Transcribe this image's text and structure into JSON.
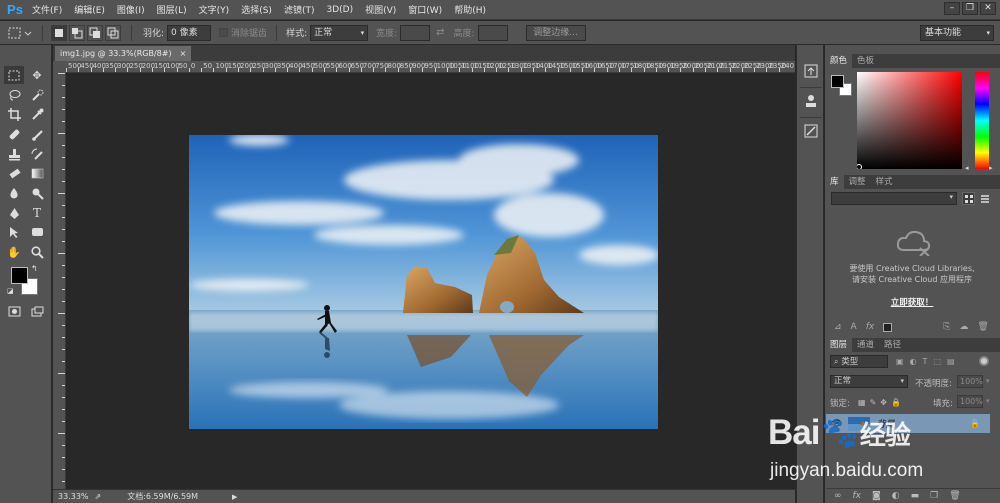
{
  "app": {
    "logo": "Ps"
  },
  "menu": [
    "文件(F)",
    "编辑(E)",
    "图像(I)",
    "图层(L)",
    "文字(Y)",
    "选择(S)",
    "滤镜(T)",
    "3D(D)",
    "视图(V)",
    "窗口(W)",
    "帮助(H)"
  ],
  "window_controls": [
    "–",
    "❐",
    "✕"
  ],
  "options_bar": {
    "feather_label": "羽化:",
    "feather_value": "0 像素",
    "antialias_label": "消除锯齿",
    "style_label": "样式:",
    "style_value": "正常",
    "width_label": "宽度:",
    "height_label": "高度:",
    "refine_edge_label": "调整边缘...",
    "workspace": "基本功能"
  },
  "document": {
    "tab_title": "img1.jpg @ 33.3%(RGB/8#)",
    "tab_close": "×",
    "ruler_labels": [
      "500",
      "450",
      "400",
      "350",
      "300",
      "250",
      "200",
      "150",
      "100",
      "50",
      "0",
      "50",
      "100",
      "150",
      "200",
      "250",
      "300",
      "350",
      "400",
      "450",
      "500",
      "550",
      "600",
      "650",
      "700",
      "750",
      "800",
      "850",
      "900",
      "950",
      "1000",
      "1050",
      "1100",
      "1150",
      "1200",
      "1250",
      "1300",
      "1350",
      "1400",
      "1450",
      "1500",
      "1550",
      "1600",
      "1650",
      "1700",
      "1750",
      "1800",
      "1850",
      "1900",
      "1950",
      "2000",
      "2050",
      "2100",
      "2150",
      "2200",
      "2250",
      "2300",
      "2350",
      "240"
    ]
  },
  "status": {
    "zoom": "33.33%",
    "doc_info": "文档:6.59M/6.59M"
  },
  "color_panel": {
    "tabs": [
      "颜色",
      "色板"
    ],
    "fg_color": "#000000",
    "bg_color": "#ffffff"
  },
  "library_panel": {
    "tabs": [
      "库",
      "调整",
      "样式"
    ],
    "message_line1": "要使用 Creative Cloud Libraries,",
    "message_line2": "请安装 Creative Cloud 应用程序",
    "link": "立即获取！"
  },
  "layers_panel": {
    "tabs": [
      "图层",
      "通道",
      "路径"
    ],
    "filter_label": "类型",
    "blend_mode": "正常",
    "opacity_label": "不透明度:",
    "opacity_value": "100%",
    "lock_label": "锁定:",
    "fill_label": "填充:",
    "fill_value": "100%",
    "layer_name": "背景"
  },
  "watermark": {
    "brand": "Bai",
    "brand2": "经验",
    "url": "jingyan.baidu.com"
  }
}
